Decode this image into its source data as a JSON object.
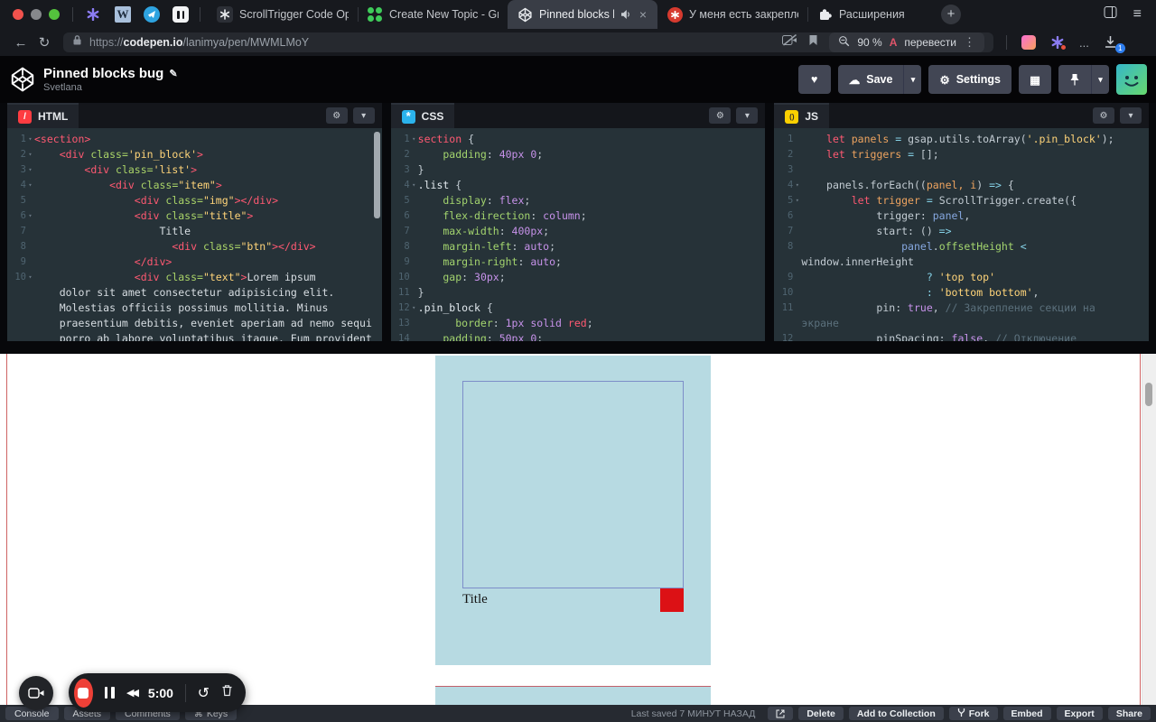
{
  "browser": {
    "pinned_icon_names": [
      "asterisk-extension-icon",
      "wikipedia-icon",
      "telegram-icon",
      "pause-app-icon"
    ],
    "tabs": [
      {
        "title": "ScrollTrigger Code Optimi",
        "icon": "gsap-docs"
      },
      {
        "title": "Create New Topic - GreenS",
        "icon": "gsap-forum"
      },
      {
        "title": "Pinned blocks bug",
        "icon": "codepen",
        "active": true,
        "audio": true,
        "closable": true
      },
      {
        "title": "У меня есть закрепленны",
        "icon": "red-app"
      },
      {
        "title": "Расширения",
        "icon": "puzzle"
      }
    ],
    "address": {
      "scheme": "https://",
      "domain": "codepen.io",
      "path": "/lanimya/pen/MWMLMoY",
      "zoom_level": "90 %",
      "translate_label": "перевести",
      "more_extensions": "...",
      "downloads_badge": "1"
    }
  },
  "header": {
    "title": "Pinned blocks bug",
    "author": "Svetlana",
    "save_label": "Save",
    "settings_label": "Settings"
  },
  "editors": [
    {
      "id": "html",
      "label": "HTML",
      "lines": [
        {
          "n": "1",
          "f": true,
          "t": [
            [
              "tag",
              "<section>"
            ]
          ]
        },
        {
          "n": "2",
          "f": true,
          "t": [
            [
              "plain",
              "    "
            ],
            [
              "tag",
              "<div"
            ],
            [
              "attr",
              " class="
            ],
            [
              "str",
              "'pin_block'"
            ],
            [
              "tag",
              ">"
            ]
          ]
        },
        {
          "n": "3",
          "f": true,
          "t": [
            [
              "plain",
              "        "
            ],
            [
              "tag",
              "<div"
            ],
            [
              "attr",
              " class="
            ],
            [
              "str",
              "'list'"
            ],
            [
              "tag",
              ">"
            ]
          ]
        },
        {
          "n": "4",
          "f": true,
          "t": [
            [
              "plain",
              "            "
            ],
            [
              "tag",
              "<div"
            ],
            [
              "attr",
              " class="
            ],
            [
              "str",
              "\"item\""
            ],
            [
              "tag",
              ">"
            ]
          ]
        },
        {
          "n": "5",
          "t": [
            [
              "plain",
              "                "
            ],
            [
              "tag",
              "<div"
            ],
            [
              "attr",
              " class="
            ],
            [
              "str",
              "\"img\""
            ],
            [
              "tag",
              "></div>"
            ]
          ]
        },
        {
          "n": "6",
          "f": true,
          "t": [
            [
              "plain",
              "                "
            ],
            [
              "tag",
              "<div"
            ],
            [
              "attr",
              " class="
            ],
            [
              "str",
              "\"title\""
            ],
            [
              "tag",
              ">"
            ]
          ]
        },
        {
          "n": "7",
          "t": [
            [
              "txt",
              "                    Title"
            ]
          ]
        },
        {
          "n": "8",
          "t": [
            [
              "plain",
              "                      "
            ],
            [
              "tag",
              "<div"
            ],
            [
              "attr",
              " class="
            ],
            [
              "str",
              "\"btn\""
            ],
            [
              "tag",
              "></div>"
            ]
          ]
        },
        {
          "n": "9",
          "t": [
            [
              "plain",
              "                "
            ],
            [
              "tag",
              "</div>"
            ]
          ]
        },
        {
          "n": "10",
          "f": true,
          "t": [
            [
              "plain",
              "                "
            ],
            [
              "tag",
              "<div"
            ],
            [
              "attr",
              " class="
            ],
            [
              "str",
              "\"text\""
            ],
            [
              "tag",
              ">"
            ],
            [
              "txt",
              "Lorem ipsum"
            ]
          ]
        },
        {
          "n": "",
          "t": [
            [
              "txt",
              "    dolor sit amet consectetur adipisicing elit."
            ]
          ]
        },
        {
          "n": "",
          "t": [
            [
              "txt",
              "    Molestias officiis possimus mollitia. Minus"
            ]
          ]
        },
        {
          "n": "",
          "t": [
            [
              "txt",
              "    praesentium debitis, eveniet aperiam ad nemo sequi"
            ]
          ]
        },
        {
          "n": "",
          "t": [
            [
              "txt",
              "    porro ab labore voluptatibus itaque. Eum provident"
            ]
          ]
        }
      ]
    },
    {
      "id": "css",
      "label": "CSS",
      "lines": [
        {
          "n": "1",
          "f": true,
          "t": [
            [
              "sel",
              "section"
            ],
            [
              "plain",
              " {"
            ]
          ]
        },
        {
          "n": "2",
          "t": [
            [
              "plain",
              "    "
            ],
            [
              "prop",
              "padding"
            ],
            [
              "plain",
              ": "
            ],
            [
              "num",
              "40px"
            ],
            [
              "plain",
              " "
            ],
            [
              "num",
              "0"
            ],
            [
              "plain",
              ";"
            ]
          ]
        },
        {
          "n": "3",
          "t": [
            [
              "plain",
              "}"
            ]
          ]
        },
        {
          "n": "4",
          "f": true,
          "t": [
            [
              "selc",
              ".list"
            ],
            [
              "plain",
              " {"
            ]
          ]
        },
        {
          "n": "5",
          "t": [
            [
              "plain",
              "    "
            ],
            [
              "prop",
              "display"
            ],
            [
              "plain",
              ": "
            ],
            [
              "val",
              "flex"
            ],
            [
              "plain",
              ";"
            ]
          ]
        },
        {
          "n": "6",
          "t": [
            [
              "plain",
              "    "
            ],
            [
              "prop",
              "flex-direction"
            ],
            [
              "plain",
              ": "
            ],
            [
              "val",
              "column"
            ],
            [
              "plain",
              ";"
            ]
          ]
        },
        {
          "n": "7",
          "t": [
            [
              "plain",
              "    "
            ],
            [
              "prop",
              "max-width"
            ],
            [
              "plain",
              ": "
            ],
            [
              "num",
              "400px"
            ],
            [
              "plain",
              ";"
            ]
          ]
        },
        {
          "n": "8",
          "t": [
            [
              "plain",
              "    "
            ],
            [
              "prop",
              "margin-left"
            ],
            [
              "plain",
              ": "
            ],
            [
              "val",
              "auto"
            ],
            [
              "plain",
              ";"
            ]
          ]
        },
        {
          "n": "9",
          "t": [
            [
              "plain",
              "    "
            ],
            [
              "prop",
              "margin-right"
            ],
            [
              "plain",
              ": "
            ],
            [
              "val",
              "auto"
            ],
            [
              "plain",
              ";"
            ]
          ]
        },
        {
          "n": "10",
          "t": [
            [
              "plain",
              "    "
            ],
            [
              "prop",
              "gap"
            ],
            [
              "plain",
              ": "
            ],
            [
              "num",
              "30px"
            ],
            [
              "plain",
              ";"
            ]
          ]
        },
        {
          "n": "11",
          "t": [
            [
              "plain",
              "}"
            ]
          ]
        },
        {
          "n": "12",
          "f": true,
          "t": [
            [
              "selc",
              ".pin_block"
            ],
            [
              "plain",
              " {"
            ]
          ]
        },
        {
          "n": "13",
          "t": [
            [
              "plain",
              "      "
            ],
            [
              "prop",
              "border"
            ],
            [
              "plain",
              ": "
            ],
            [
              "num",
              "1px"
            ],
            [
              "plain",
              " "
            ],
            [
              "val",
              "solid"
            ],
            [
              "plain",
              " "
            ],
            [
              "red",
              "red"
            ],
            [
              "plain",
              ";"
            ]
          ]
        },
        {
          "n": "14",
          "t": [
            [
              "plain",
              "    "
            ],
            [
              "prop",
              "padding"
            ],
            [
              "plain",
              ": "
            ],
            [
              "num",
              "50px"
            ],
            [
              "plain",
              " "
            ],
            [
              "num",
              "0"
            ],
            [
              "plain",
              ";"
            ]
          ]
        }
      ]
    },
    {
      "id": "js",
      "label": "JS",
      "lines": [
        {
          "n": "1",
          "t": [
            [
              "plain",
              "    "
            ],
            [
              "kw",
              "let"
            ],
            [
              "var",
              " panels"
            ],
            [
              "op",
              " = "
            ],
            [
              "plain",
              "gsap.utils.toArray("
            ],
            [
              "str",
              "'.pin_block'"
            ],
            [
              "plain",
              ");"
            ]
          ]
        },
        {
          "n": "2",
          "t": [
            [
              "plain",
              "    "
            ],
            [
              "kw",
              "let"
            ],
            [
              "var",
              " triggers"
            ],
            [
              "op",
              " = "
            ],
            [
              "plain",
              "[];"
            ]
          ]
        },
        {
          "n": "3",
          "t": []
        },
        {
          "n": "4",
          "f": true,
          "t": [
            [
              "plain",
              "    panels.forEach(("
            ],
            [
              "var",
              "panel, i"
            ],
            [
              "plain",
              ") "
            ],
            [
              "op",
              "=>"
            ],
            [
              "plain",
              " {"
            ]
          ]
        },
        {
          "n": "5",
          "f": true,
          "t": [
            [
              "plain",
              "        "
            ],
            [
              "kw",
              "let"
            ],
            [
              "var",
              " trigger"
            ],
            [
              "op",
              " = "
            ],
            [
              "plain",
              "ScrollTrigger.create({"
            ]
          ]
        },
        {
          "n": "6",
          "t": [
            [
              "plain",
              "            trigger: "
            ],
            [
              "id",
              "panel"
            ],
            [
              "plain",
              ","
            ]
          ]
        },
        {
          "n": "7",
          "t": [
            [
              "plain",
              "            start: () "
            ],
            [
              "op",
              "=>"
            ]
          ]
        },
        {
          "n": "8",
          "t": [
            [
              "plain",
              "                "
            ],
            [
              "id",
              "panel"
            ],
            [
              "plain",
              "."
            ],
            [
              "prop",
              "offsetHeight"
            ],
            [
              "op",
              " <"
            ]
          ]
        },
        {
          "n": "",
          "t": [
            [
              "plain",
              "window.innerHeight"
            ]
          ]
        },
        {
          "n": "9",
          "t": [
            [
              "plain",
              "                    "
            ],
            [
              "op",
              "? "
            ],
            [
              "str",
              "'top top'"
            ]
          ]
        },
        {
          "n": "10",
          "t": [
            [
              "plain",
              "                    "
            ],
            [
              "op",
              ": "
            ],
            [
              "str",
              "'bottom bottom'"
            ],
            [
              "plain",
              ","
            ]
          ]
        },
        {
          "n": "11",
          "t": [
            [
              "plain",
              "            pin: "
            ],
            [
              "bool",
              "true"
            ],
            [
              "plain",
              ", "
            ],
            [
              "cmt",
              "// Закрепление секции на"
            ]
          ]
        },
        {
          "n": "",
          "t": [
            [
              "cmt",
              "экране"
            ]
          ]
        },
        {
          "n": "12",
          "t": [
            [
              "plain",
              "            pinSpacing: "
            ],
            [
              "bool",
              "false"
            ],
            [
              "plain",
              ", "
            ],
            [
              "cmt",
              "// Отключение"
            ]
          ]
        }
      ]
    }
  ],
  "preview": {
    "item_title": "Title"
  },
  "recorder": {
    "time": "5:00"
  },
  "footer": {
    "tabs": [
      {
        "label": "Console"
      },
      {
        "label": "Assets"
      },
      {
        "label": "Comments"
      },
      {
        "label": "Keys",
        "icon": "command"
      }
    ],
    "saved_label": "Last saved",
    "saved_ago": "7 МИНУТ НАЗАД",
    "actions": [
      {
        "label": "Delete"
      },
      {
        "label": "Add to Collection"
      },
      {
        "label": "Fork",
        "icon": "fork"
      },
      {
        "label": "Embed"
      },
      {
        "label": "Export"
      },
      {
        "label": "Share"
      }
    ]
  }
}
